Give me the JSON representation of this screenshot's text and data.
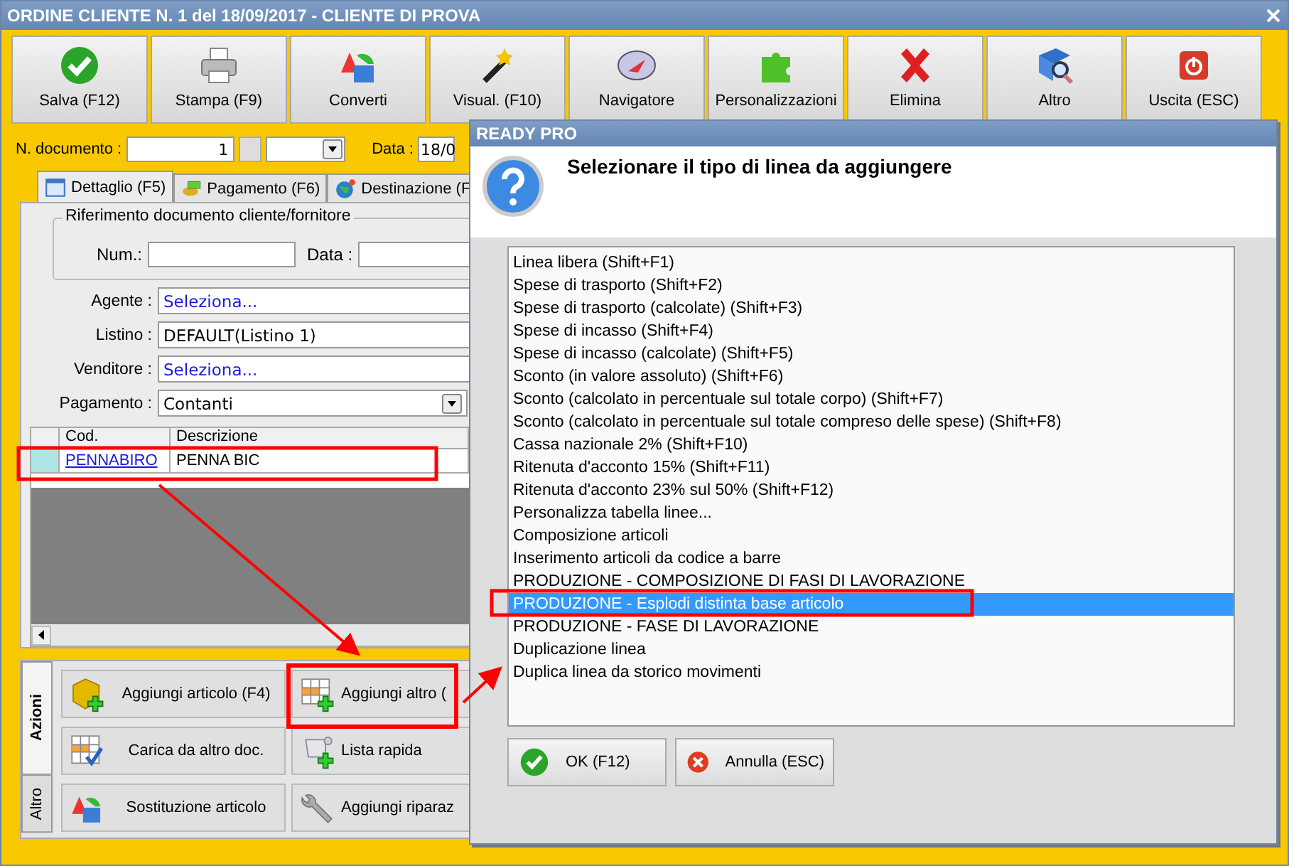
{
  "window": {
    "title": "ORDINE CLIENTE N. 1 del 18/09/2017 - CLIENTE DI PROVA"
  },
  "toolbar": [
    {
      "label": "Salva (F12)",
      "kind": "check"
    },
    {
      "label": "Stampa (F9)",
      "kind": "printer"
    },
    {
      "label": "Converti",
      "kind": "convert"
    },
    {
      "label": "Visual. (F10)",
      "kind": "wand"
    },
    {
      "label": "Navigatore",
      "kind": "compass"
    },
    {
      "label": "Personalizzazioni",
      "kind": "puzzle"
    },
    {
      "label": "Elimina",
      "kind": "cross"
    },
    {
      "label": "Altro",
      "kind": "book"
    },
    {
      "label": "Uscita (ESC)",
      "kind": "power"
    }
  ],
  "document_row": {
    "number_label": "N. documento :",
    "number_value": "1",
    "date_label": "Data :",
    "date_value": "18/0"
  },
  "tabs": [
    {
      "label": "Dettaglio (F5)",
      "selected": true,
      "kind": "calendar"
    },
    {
      "label": "Pagamento (F6)",
      "selected": false,
      "kind": "money"
    },
    {
      "label": "Destinazione (F",
      "selected": false,
      "kind": "globe"
    }
  ],
  "reference_group": {
    "title": "Riferimento documento cliente/fornitore",
    "number_label": "Num.:",
    "date_label": "Data :"
  },
  "fields": [
    {
      "label": "Agente :",
      "value": "Seleziona...",
      "kind": "link"
    },
    {
      "label": "Listino :",
      "value": "DEFAULT(Listino 1)",
      "kind": "text"
    },
    {
      "label": "Venditore :",
      "value": "Seleziona...",
      "kind": "link"
    },
    {
      "label": "Pagamento :",
      "value": "Contanti",
      "kind": "dropdown"
    }
  ],
  "grid": {
    "columns": [
      "Cod.",
      "Descrizione"
    ],
    "rows": [
      {
        "cells": [
          "PENNABIRO",
          "PENNA BIC"
        ]
      }
    ]
  },
  "action_tabs": [
    {
      "label": "Azioni",
      "selected": true
    },
    {
      "label": "Altro",
      "selected": false
    }
  ],
  "actions": [
    {
      "label": "Aggiungi articolo (F4)",
      "kind": "box"
    },
    {
      "label": "Aggiungi altro (",
      "kind": "table-add"
    },
    {
      "label": "Carica da altro doc.",
      "kind": "table-check"
    },
    {
      "label": "Lista rapida",
      "kind": "scroll"
    },
    {
      "label": "Sostituzione articolo",
      "kind": "convert"
    },
    {
      "label": "Aggiungi riparaz",
      "kind": "wrench"
    }
  ],
  "dialog": {
    "title": "READY PRO",
    "heading": "Selezionare il tipo di linea da aggiungere",
    "items": [
      {
        "label": "Linea libera (Shift+F1)",
        "selected": false
      },
      {
        "label": "Spese di trasporto (Shift+F2)",
        "selected": false
      },
      {
        "label": "Spese di trasporto (calcolate) (Shift+F3)",
        "selected": false
      },
      {
        "label": "Spese di incasso (Shift+F4)",
        "selected": false
      },
      {
        "label": "Spese di incasso (calcolate) (Shift+F5)",
        "selected": false
      },
      {
        "label": "Sconto (in valore assoluto) (Shift+F6)",
        "selected": false
      },
      {
        "label": "Sconto (calcolato in percentuale sul totale corpo) (Shift+F7)",
        "selected": false
      },
      {
        "label": "Sconto (calcolato in percentuale sul totale compreso delle spese) (Shift+F8)",
        "selected": false
      },
      {
        "label": "Cassa nazionale 2% (Shift+F10)",
        "selected": false
      },
      {
        "label": "Ritenuta d'acconto 15% (Shift+F11)",
        "selected": false
      },
      {
        "label": "Ritenuta d'acconto 23% sul 50% (Shift+F12)",
        "selected": false
      },
      {
        "label": "Personalizza tabella linee...",
        "selected": false
      },
      {
        "label": "Composizione articoli",
        "selected": false
      },
      {
        "label": "Inserimento articoli da codice a barre",
        "selected": false
      },
      {
        "label": "PRODUZIONE - COMPOSIZIONE DI FASI DI LAVORAZIONE",
        "selected": false
      },
      {
        "label": "PRODUZIONE - Esplodi distinta base articolo",
        "selected": true
      },
      {
        "label": "PRODUZIONE - FASE DI LAVORAZIONE",
        "selected": false
      },
      {
        "label": "Duplicazione linea",
        "selected": false
      },
      {
        "label": "Duplica linea da storico movimenti",
        "selected": false
      }
    ],
    "buttons": [
      {
        "label": "OK (F12)",
        "kind": "ok"
      },
      {
        "label": "Annulla (ESC)",
        "kind": "cancel"
      }
    ]
  }
}
